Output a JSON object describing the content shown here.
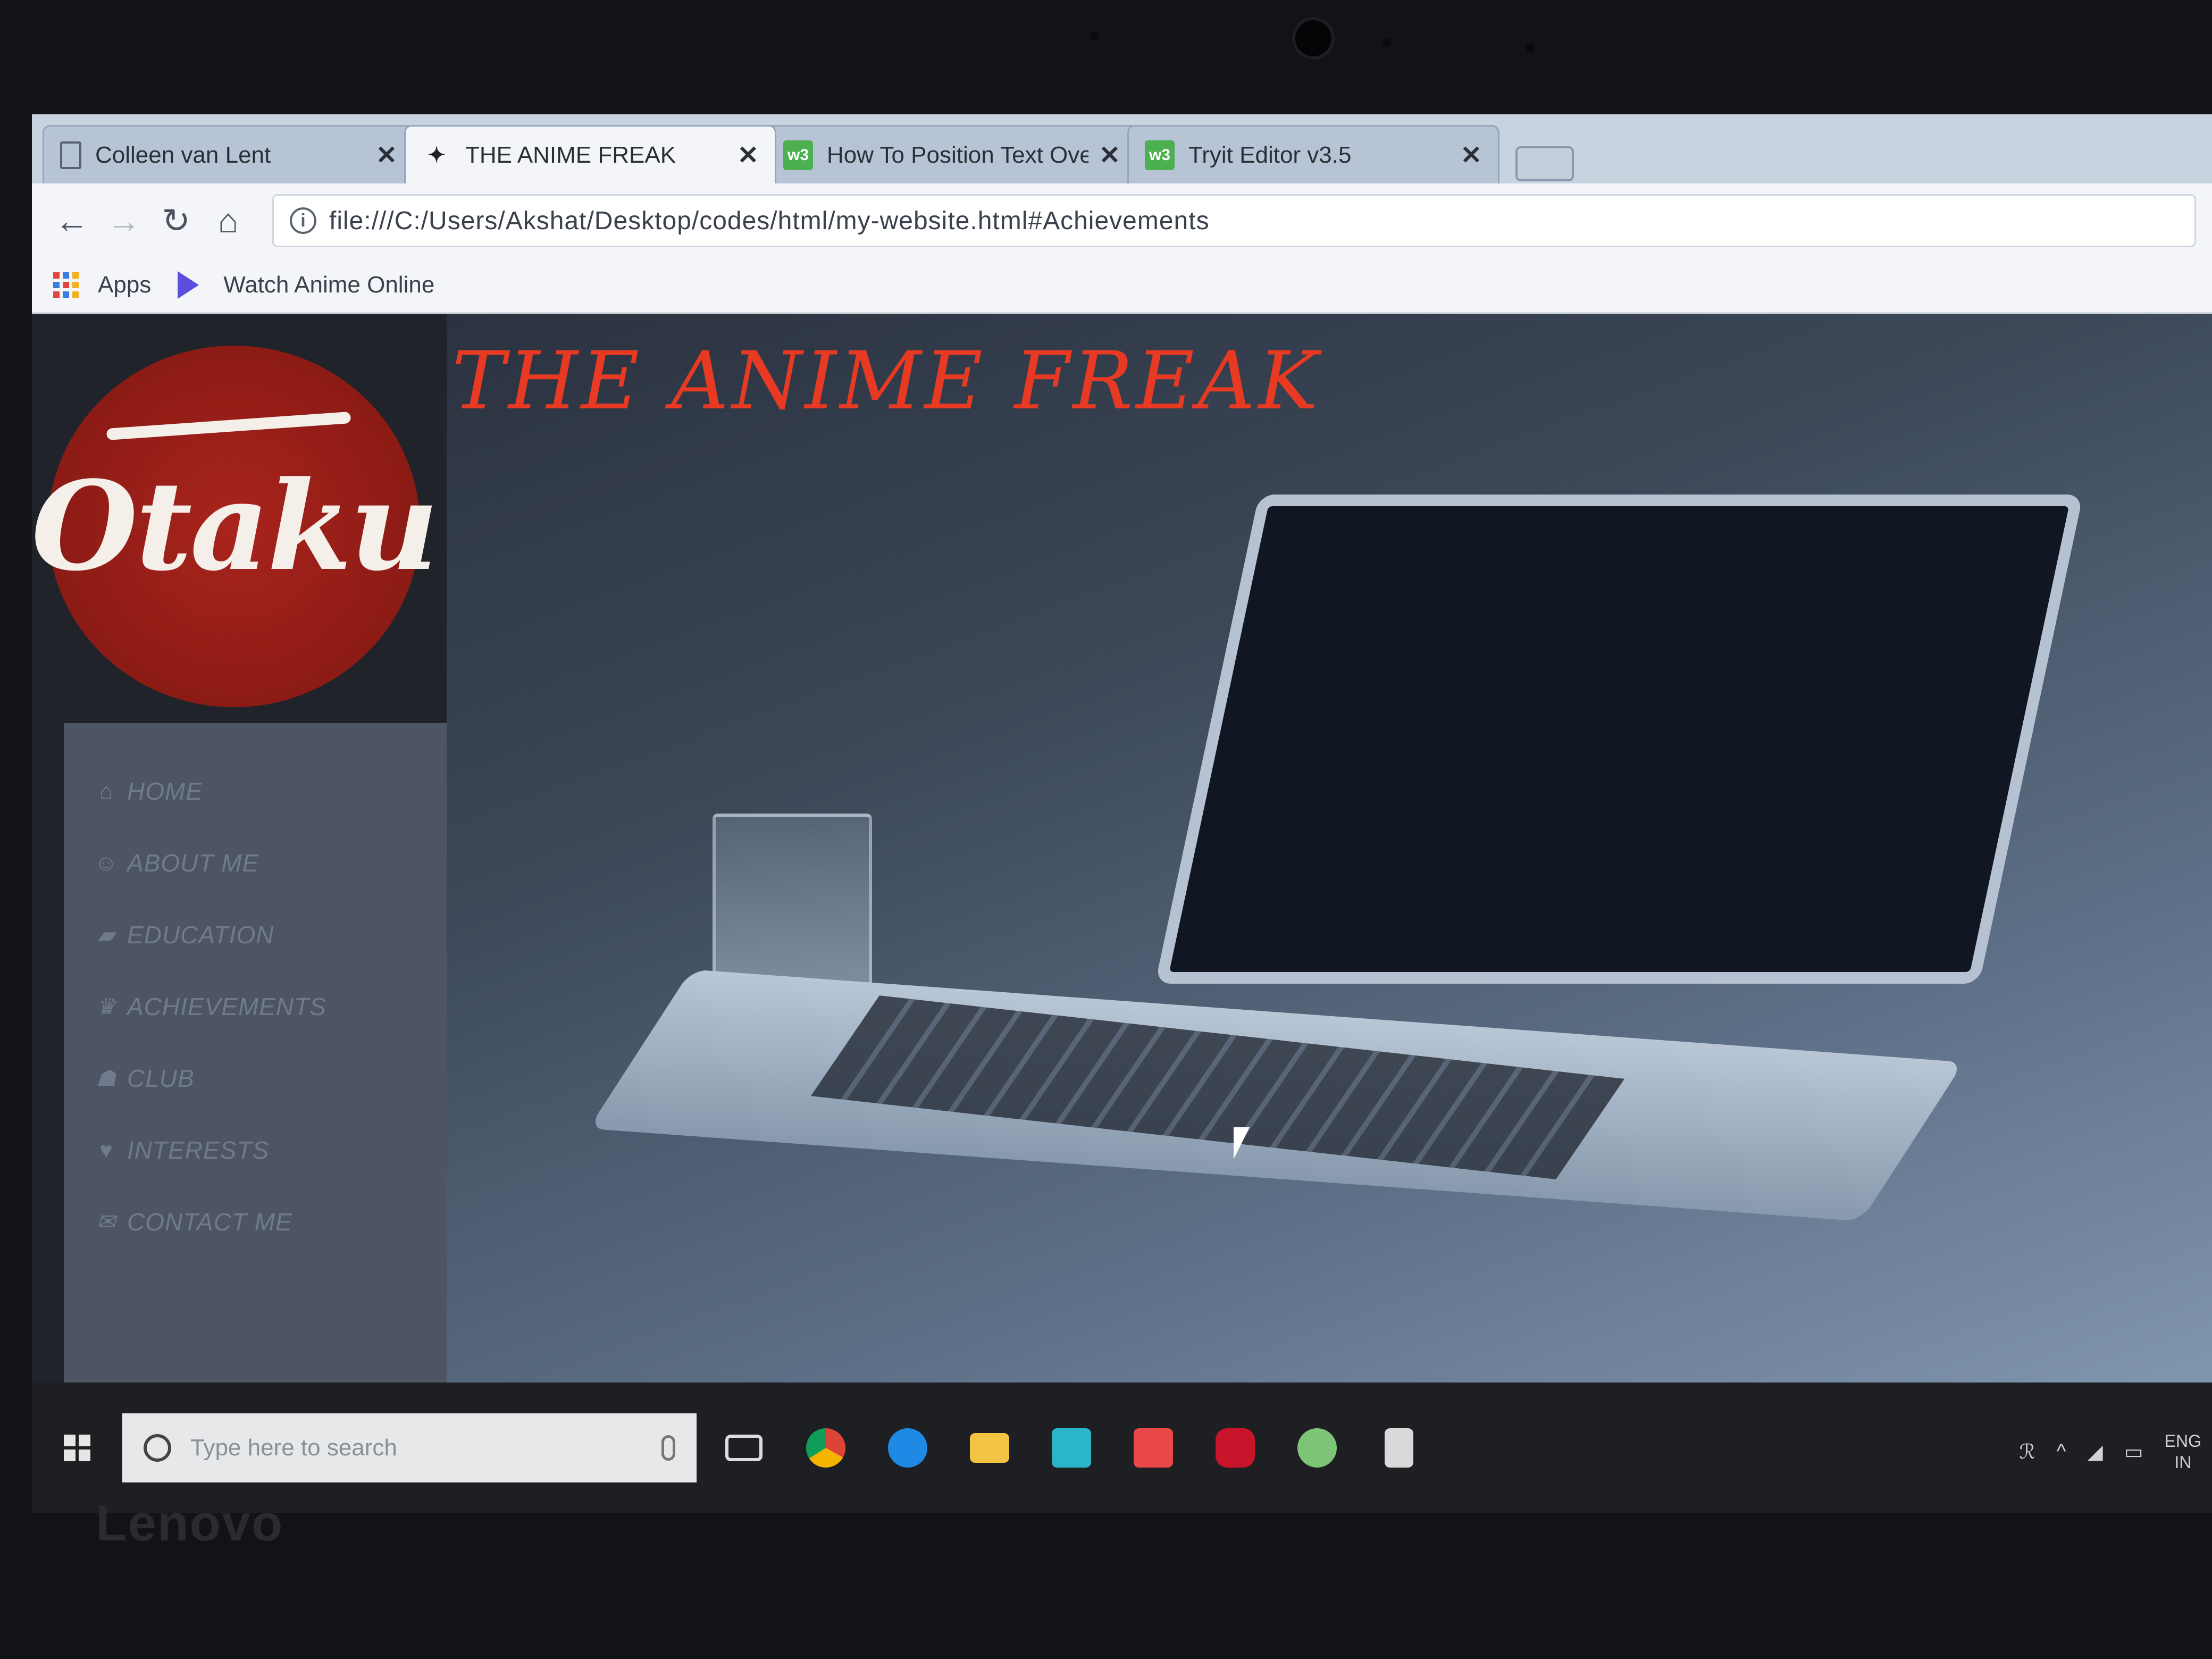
{
  "browser": {
    "tabs": [
      {
        "title": "Colleen van Lent",
        "icon": "document-icon",
        "active": false
      },
      {
        "title": "THE ANIME FREAK",
        "icon": "anime-icon",
        "active": true
      },
      {
        "title": "How To Position Text Ove",
        "icon": "w3schools-icon",
        "active": false
      },
      {
        "title": "Tryit Editor v3.5",
        "icon": "w3schools-icon",
        "active": false
      }
    ],
    "tab_close": "✕",
    "url": "file:///C:/Users/Akshat/Desktop/codes/html/my-website.html#Achievements",
    "info_glyph": "i",
    "bookmarks": {
      "apps_label": "Apps",
      "items": [
        "Watch Anime Online"
      ]
    }
  },
  "page": {
    "site_title": "THE ANIME FREAK",
    "logo_text": "Otaku",
    "nav": [
      {
        "label": "HOME",
        "icon": "home-icon",
        "glyph": "⌂"
      },
      {
        "label": "ABOUT ME",
        "icon": "user-icon",
        "glyph": "☺"
      },
      {
        "label": "EDUCATION",
        "icon": "graduation-cap-icon",
        "glyph": "▰"
      },
      {
        "label": "ACHIEVEMENTS",
        "icon": "trophy-icon",
        "glyph": "♛"
      },
      {
        "label": "CLUB",
        "icon": "group-icon",
        "glyph": "☗"
      },
      {
        "label": "INTERESTS",
        "icon": "heart-icon",
        "glyph": "♥"
      },
      {
        "label": "CONTACT ME",
        "icon": "envelope-icon",
        "glyph": "✉"
      }
    ],
    "colors": {
      "title": "#e83a22",
      "logo_red": "#a8241c",
      "sidebar": "#4d5565"
    }
  },
  "taskbar": {
    "search_placeholder": "Type here to search",
    "apps": [
      "task-view-icon",
      "chrome-icon",
      "edge-icon",
      "file-explorer-icon",
      "lenovo-l-icon",
      "red-app-icon",
      "mcafee-icon",
      "globe-icon",
      "notepad-icon"
    ],
    "tray_lang_1": "ENG",
    "tray_lang_2": "IN",
    "tray_people": "ℛ",
    "tray_chevron": "^"
  },
  "device": {
    "brand": "Lenovo"
  }
}
